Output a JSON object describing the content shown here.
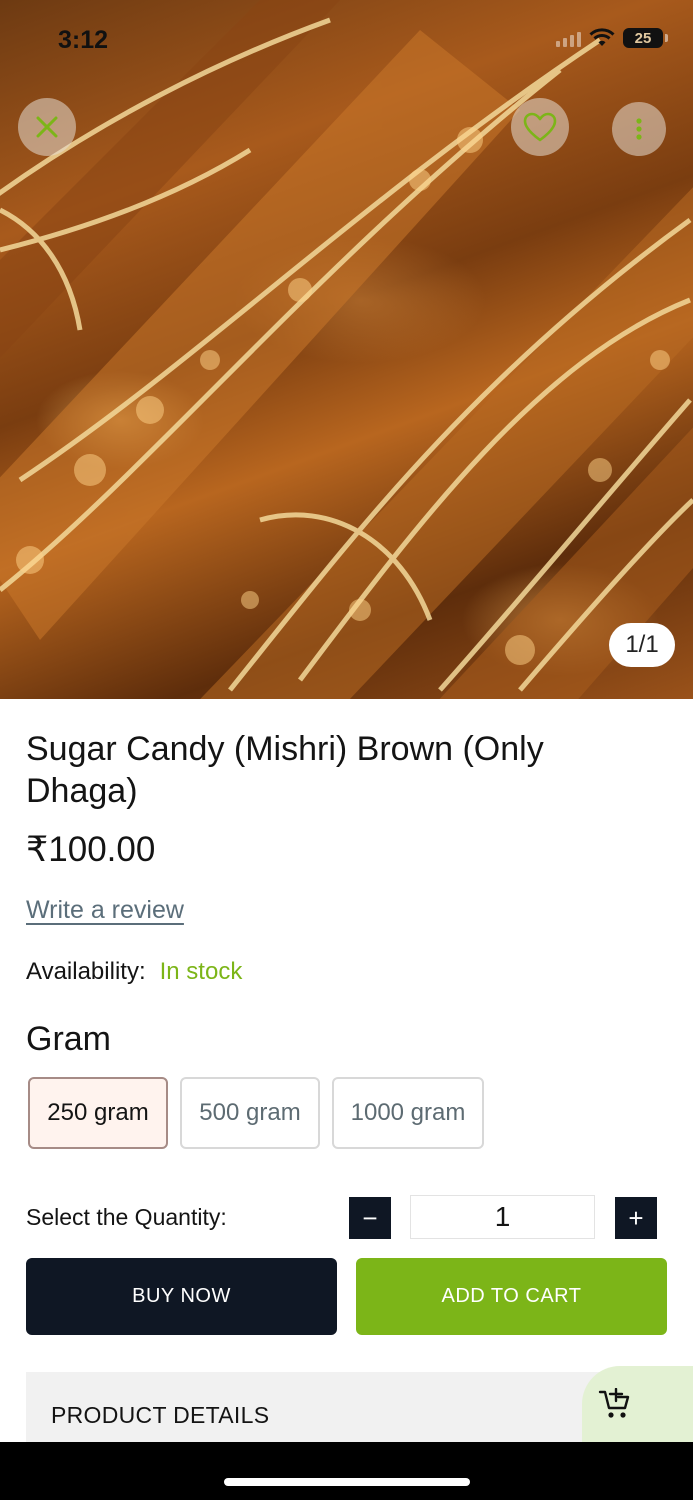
{
  "status_bar": {
    "time": "3:12",
    "battery": "25"
  },
  "gallery": {
    "counter": "1/1"
  },
  "product": {
    "title": "Sugar Candy (Mishri) Brown (Only Dhaga)",
    "price": "₹100.00",
    "review_link": "Write a review",
    "availability_label": "Availability:",
    "availability_value": "In stock"
  },
  "variants": {
    "heading": "Gram",
    "options": [
      "250 gram",
      "500 gram",
      "1000 gram"
    ],
    "selected": "250 gram"
  },
  "quantity": {
    "label": "Select the Quantity:",
    "value": "1",
    "minus": "−",
    "plus": "+"
  },
  "actions": {
    "buy_now": "BUY NOW",
    "add_to_cart": "ADD TO CART"
  },
  "details": {
    "label": "PRODUCT DETAILS"
  },
  "colors": {
    "accent_green": "#7cb518",
    "dark": "#0f1724",
    "stock_green": "#7cb518"
  },
  "icons": [
    "close-icon",
    "heart-icon",
    "more-vertical-icon",
    "wifi-icon",
    "battery-icon",
    "cart-add-icon"
  ]
}
